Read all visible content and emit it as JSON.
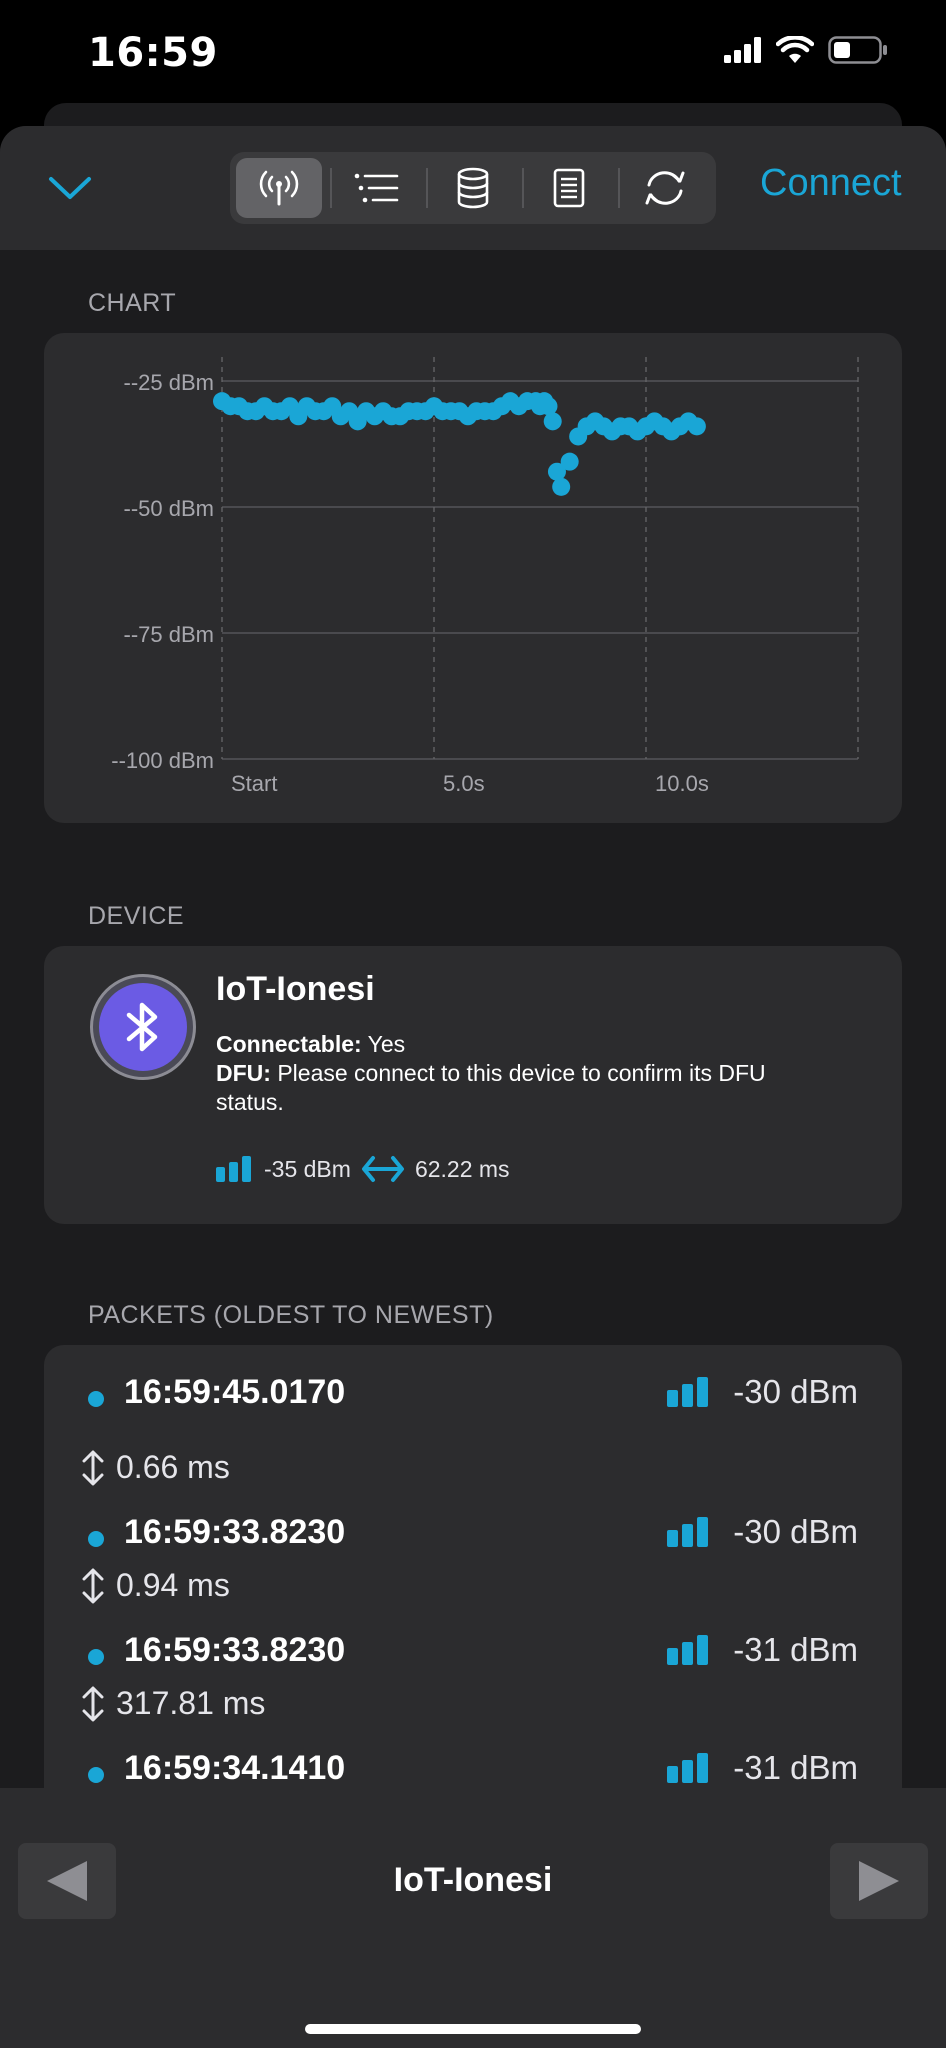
{
  "status_bar": {
    "time": "16:59",
    "icons": [
      "cellular-signal-icon",
      "wifi-icon",
      "battery-icon"
    ]
  },
  "toolbar": {
    "tabs": [
      {
        "icon": "antenna-icon",
        "active": true
      },
      {
        "icon": "list-icon",
        "active": false
      },
      {
        "icon": "database-icon",
        "active": false
      },
      {
        "icon": "document-icon",
        "active": false
      },
      {
        "icon": "refresh-icon",
        "active": false
      }
    ],
    "connect_label": "Connect",
    "accent_color": "#1aa6d6"
  },
  "chart_section": {
    "title": "CHART"
  },
  "chart_data": {
    "type": "scatter",
    "y_ticks": [
      "--25 dBm",
      "--50 dBm",
      "--75 dBm",
      "--100 dBm"
    ],
    "x_ticks": [
      "Start",
      "5.0s",
      "10.0s"
    ],
    "x_range": [
      0,
      15
    ],
    "y_range": [
      -100,
      -25
    ],
    "grid": true,
    "color": "#1aa6d6",
    "series": [
      {
        "x": [
          0.0,
          0.2,
          0.4,
          0.6,
          0.8,
          1.0,
          1.2,
          1.4,
          1.6,
          1.8,
          2.0,
          2.2,
          2.4,
          2.6,
          2.8,
          3.0,
          3.2,
          3.4,
          3.6,
          3.8,
          4.0,
          4.2,
          4.4,
          4.6,
          4.8,
          5.0,
          5.2,
          5.4,
          5.6,
          5.8,
          6.0,
          6.2,
          6.4,
          6.6,
          6.8,
          7.0,
          7.2,
          7.4,
          7.5,
          7.6,
          7.7,
          7.8,
          7.9,
          8.0,
          8.2,
          8.4,
          8.6,
          8.8,
          9.0,
          9.2,
          9.4,
          9.6,
          9.8,
          10.0,
          10.2,
          10.4,
          10.6,
          10.8,
          11.0,
          11.2
        ],
        "y": [
          -29,
          -30,
          -30,
          -31,
          -31,
          -30,
          -31,
          -31,
          -30,
          -32,
          -30,
          -31,
          -31,
          -30,
          -32,
          -31,
          -33,
          -31,
          -32,
          -31,
          -32,
          -32,
          -31,
          -31,
          -31,
          -30,
          -31,
          -31,
          -31,
          -32,
          -31,
          -31,
          -31,
          -30,
          -29,
          -30,
          -29,
          -29,
          -30,
          -29,
          -30,
          -33,
          -43,
          -46,
          -41,
          -36,
          -34,
          -33,
          -34,
          -35,
          -34,
          -34,
          -35,
          -34,
          -33,
          -34,
          -35,
          -34,
          -33,
          -34
        ]
      }
    ]
  },
  "device_section": {
    "title": "DEVICE",
    "name": "IoT-Ionesi",
    "connectable_label": "Connectable:",
    "connectable_value": " Yes",
    "dfu_label": "DFU:",
    "dfu_value": " Please connect to this device to confirm its DFU status.",
    "rssi": "-35 dBm",
    "interval": "62.22 ms",
    "avatar_icon": "bluetooth-icon"
  },
  "packets_section": {
    "title": "PACKETS (OLDEST TO NEWEST)",
    "packets": [
      {
        "time": "16:59:45.0170",
        "rssi": "-30 dBm",
        "delta": "0.66 ms"
      },
      {
        "time": "16:59:33.8230",
        "rssi": "-30 dBm",
        "delta": "0.94 ms"
      },
      {
        "time": "16:59:33.8230",
        "rssi": "-31 dBm",
        "delta": "317.81 ms"
      },
      {
        "time": "16:59:34.1410",
        "rssi": "-31 dBm"
      }
    ]
  },
  "bottom_bar": {
    "title": "IoT-Ionesi",
    "prev_icon": "triangle-left-icon",
    "next_icon": "triangle-right-icon"
  }
}
